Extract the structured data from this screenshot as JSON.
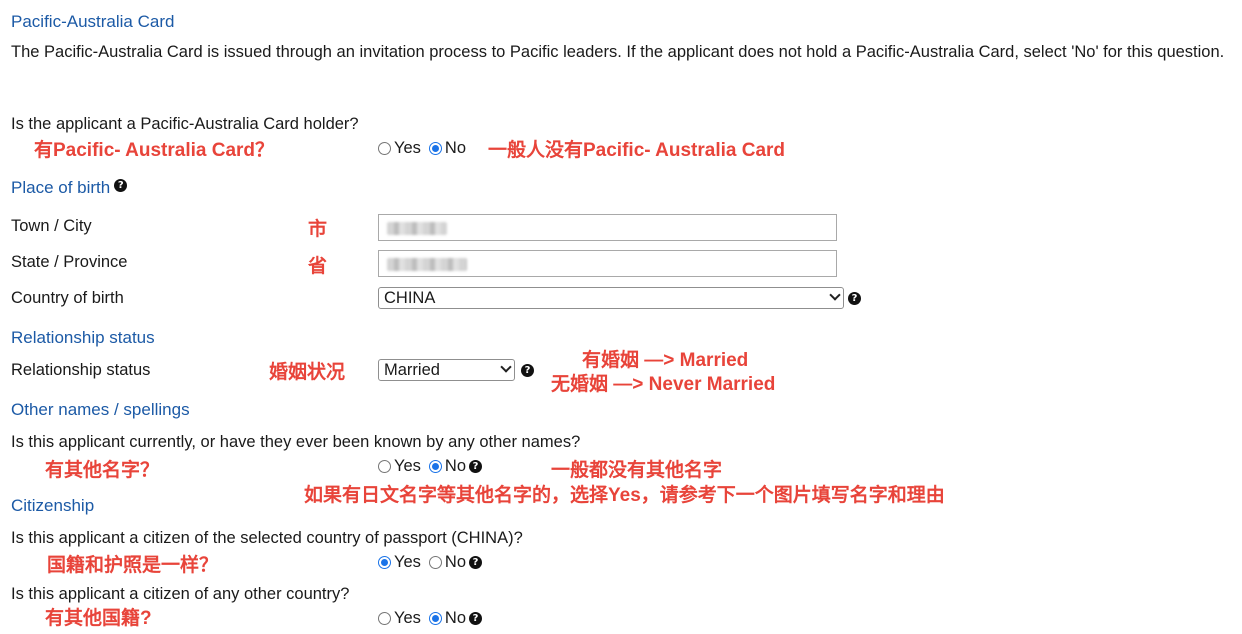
{
  "pacific_card": {
    "heading": "Pacific-Australia Card",
    "description": "The Pacific-Australia Card is issued through an invitation process to Pacific leaders. If the applicant does not hold a Pacific-Australia Card, select 'No' for this question.",
    "question": "Is the applicant a Pacific-Australia Card holder?",
    "yes_label": "Yes",
    "no_label": "No",
    "selected": "No",
    "note_left": "有Pacific- Australia Card？",
    "note_right": "一般人没有Pacific- Australia Card"
  },
  "place_of_birth": {
    "heading": "Place of birth",
    "town_label": "Town / City",
    "town_note": "市",
    "state_label": "State / Province",
    "state_note": "省",
    "country_label": "Country of birth",
    "country_value": "CHINA"
  },
  "relationship": {
    "heading": "Relationship status",
    "label": "Relationship status",
    "note": "婚姻状况",
    "value": "Married",
    "note_married": "有婚姻  —> Married",
    "note_never": "无婚姻  —> Never Married"
  },
  "other_names": {
    "heading": "Other names / spellings",
    "question": "Is this applicant currently, or have they ever been known by any other names?",
    "note_left": "有其他名字？",
    "yes_label": "Yes",
    "no_label": "No",
    "selected": "No",
    "note_right": "一般都没有其他名字",
    "note_bottom": "如果有日文名字等其他名字的，选择Yes，请参考下一个图片填写名字和理由"
  },
  "citizenship": {
    "heading": "Citizenship",
    "q1": "Is this applicant a citizen of the selected country of passport (CHINA)?",
    "q1_note": "国籍和护照是一样？",
    "q1_yes": "Yes",
    "q1_no": "No",
    "q1_selected": "Yes",
    "q2": "Is this applicant a citizen of any other country?",
    "q2_note": "有其他国籍?",
    "q2_yes": "Yes",
    "q2_no": "No",
    "q2_selected": "No"
  },
  "help_glyph": "?",
  "icons": [
    "help-icon",
    "chevron-down-icon",
    "radio-icon"
  ],
  "colors": {
    "section_heading": "#1c5aa6",
    "annotation": "#e8443a",
    "radio_checked": "#1a73e8"
  }
}
